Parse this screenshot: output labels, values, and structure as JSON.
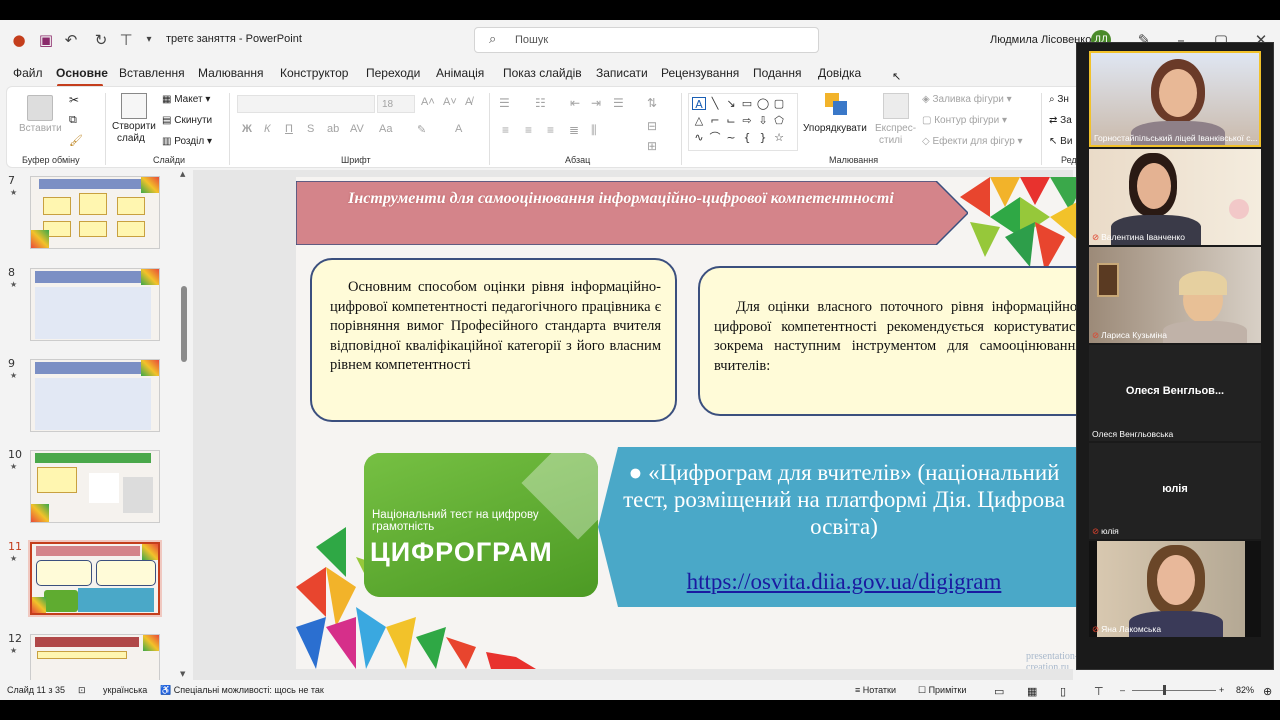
{
  "titlebar": {
    "doc_name": "третє заняття",
    "app_name": "PowerPoint",
    "search_placeholder": "Пошук",
    "user_name": "Людмила Лісовенко",
    "user_initials": "ЛЛ"
  },
  "menu": [
    "Файл",
    "Основне",
    "Вставлення",
    "Малювання",
    "Конструктор",
    "Переходи",
    "Анімація",
    "Показ слайдів",
    "Записати",
    "Рецензування",
    "Подання",
    "Довідка"
  ],
  "ribbon": {
    "clipboard": {
      "paste": "Вставити",
      "group": "Буфер обміну"
    },
    "slides": {
      "new_slide_1": "Створити",
      "new_slide_2": "слайд",
      "layout": "Макет",
      "reset": "Скинути",
      "section": "Розділ",
      "group": "Слайди"
    },
    "font": {
      "size": "18",
      "bold": "Ж",
      "italic": "К",
      "underline": "П",
      "strike": "S",
      "group": "Шрифт"
    },
    "paragraph": {
      "group": "Абзац"
    },
    "drawing": {
      "arrange": "Упорядкувати",
      "quick_styles_1": "Експрес-",
      "quick_styles_2": "стилі",
      "fill": "Заливка фігури",
      "outline": "Контур фігури",
      "effects": "Ефекти для фігур",
      "group": "Малювання"
    },
    "editing": {
      "find": "Зн",
      "replace": "За",
      "select": "Ви",
      "group": "Ред"
    }
  },
  "thumbnails": [
    {
      "num": "7",
      "star": "★"
    },
    {
      "num": "8",
      "star": "★"
    },
    {
      "num": "9",
      "star": "★"
    },
    {
      "num": "10",
      "star": "★"
    },
    {
      "num": "11",
      "star": "★",
      "selected": true
    },
    {
      "num": "12",
      "star": "★"
    }
  ],
  "slide": {
    "title": "Інструменти для самооцінювання інформаційно-цифрової компетентності",
    "box1": "Основним способом оцінки рівня інформаційно-цифрової компетентності педагогічного працівника є порівняння вимог Професійного стандарта вчителя відповідної кваліфікаційної категорії з його власним рівнем компетентності",
    "box2": "Для оцінки власного поточного рівня інформаційно-цифрової компетентності рекомендується користуватись зокрема наступним інструментом для самооцінювання вчителів:",
    "tile_subtitle": "Національний тест на цифрову грамотність",
    "tile_brand": "ЦИФРОГРАМ",
    "bullet_text": "● «Цифрограм для вчителів» (національний тест, розміщений на платформі Дія. Цифрова освіта)",
    "link": "https://osvita.diia.gov.ua/digigram",
    "watermark": "presentation-creation.ru"
  },
  "participants": [
    {
      "name": "Горностайпільський ліцей Іванківської с...",
      "video": true
    },
    {
      "name": "Валентина Іванченко",
      "video": true,
      "muted": true
    },
    {
      "name": "Лариса Кузьміна",
      "video": true,
      "muted": true
    },
    {
      "name": "Олеся Венгльовська",
      "center": "Олеся  Венгльов...",
      "video": false
    },
    {
      "name": "юлія",
      "center": "юлія",
      "video": false,
      "muted": true
    },
    {
      "name": "Яна Лакомська",
      "video": true,
      "muted": true
    }
  ],
  "status": {
    "slide_info": "Слайд 11 з 35",
    "language": "українська",
    "accessibility": "Спеціальні можливості: щось не так",
    "notes": "Нотатки",
    "comments": "Примітки",
    "zoom": "82%"
  },
  "colors": {
    "accent": "#c43e1c",
    "banner": "#d4848a",
    "box_border": "#3b4f7e",
    "box_fill": "#fffbd8",
    "tile_green": "#5fac30",
    "band_blue": "#4aa8c8"
  }
}
